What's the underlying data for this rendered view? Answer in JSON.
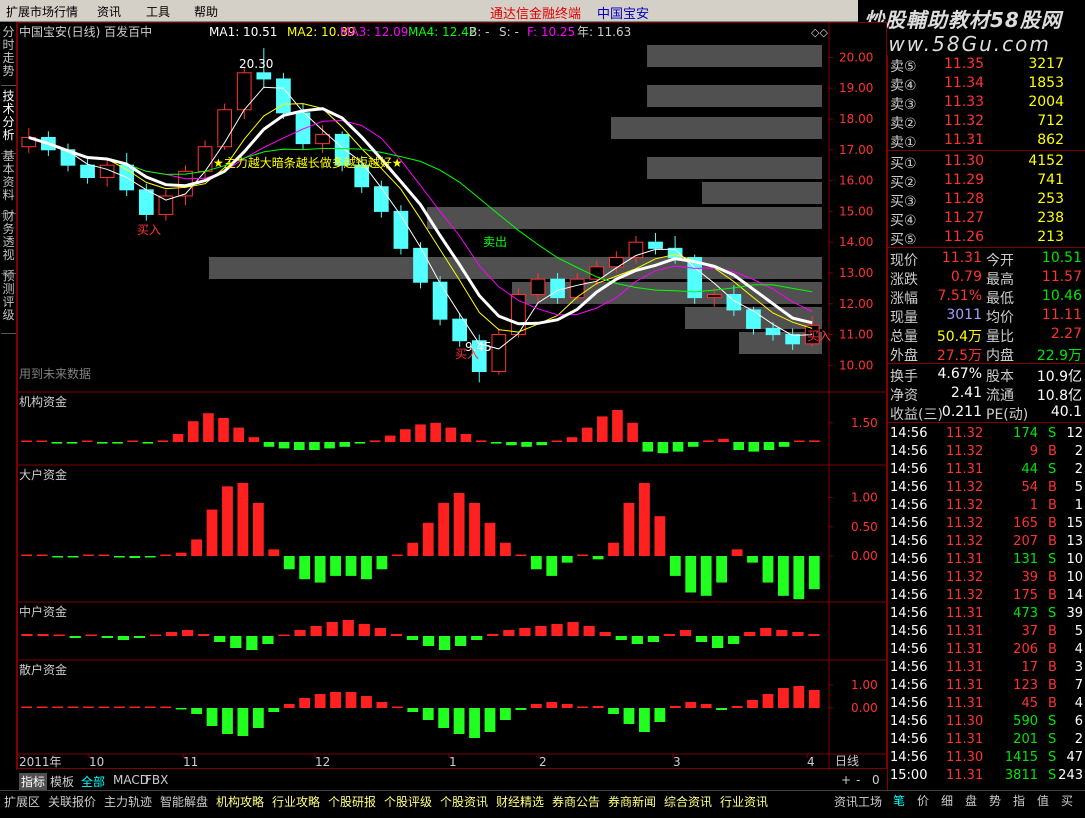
{
  "menu": {
    "items": [
      "扩展市场行情",
      "资讯",
      "工具",
      "帮助"
    ],
    "brand": "通达信金融终端",
    "stock": "中国宝安"
  },
  "watermark": {
    "line1": "炒股輔助教材58股网",
    "line2": "www.58Gu.com"
  },
  "left_tabs": [
    "分时走势",
    "技术分析",
    "基本资料",
    "财务透视",
    "预测评级"
  ],
  "chart_header": {
    "title": "中国宝安(日线) 百发百中",
    "ma1": "MA1: 10.51",
    "ma2": "MA2: 10.89",
    "ma3": "MA3: 12.09",
    "ma4": "MA4: 12.42",
    "b": "B: -",
    "s": "S: -",
    "f": "F: 10.25",
    "year": "年: 11.63"
  },
  "chart_data": [
    {
      "type": "candlestick",
      "title": "中国宝安(日线) 百发百中",
      "y_ticks": [
        10,
        11,
        12,
        13,
        14,
        15,
        16,
        17,
        18,
        19,
        20
      ],
      "y_tick_labels": [
        "10.00",
        "11.00",
        "12.00",
        "13.00",
        "14.00",
        "15.00",
        "16.00",
        "17.00",
        "18.00",
        "19.00",
        "20.00"
      ],
      "ylim": [
        9.2,
        20.5
      ],
      "x_ticks": [
        "2011年",
        "10",
        "11",
        "12",
        "1",
        "2",
        "3",
        "4"
      ],
      "annotations": [
        "20.30",
        "9.45",
        "买入",
        "卖出",
        "★主力越大暗条越长做多越短越好★",
        "用到未来数据"
      ],
      "candles": [
        [
          17.1,
          17.7,
          16.9,
          17.4
        ],
        [
          17.4,
          17.6,
          16.8,
          17.0
        ],
        [
          17.0,
          17.2,
          16.3,
          16.5
        ],
        [
          16.5,
          16.8,
          15.9,
          16.1
        ],
        [
          16.1,
          16.7,
          15.8,
          16.5
        ],
        [
          16.5,
          16.9,
          15.5,
          15.7
        ],
        [
          15.7,
          15.9,
          14.7,
          14.9
        ],
        [
          14.9,
          15.7,
          14.7,
          15.5
        ],
        [
          15.5,
          16.5,
          15.2,
          16.3
        ],
        [
          16.3,
          17.3,
          16.0,
          17.1
        ],
        [
          17.1,
          18.5,
          17.0,
          18.3
        ],
        [
          18.3,
          19.7,
          18.0,
          19.5
        ],
        [
          19.5,
          20.3,
          19.0,
          19.3
        ],
        [
          19.3,
          19.5,
          18.0,
          18.2
        ],
        [
          18.2,
          18.5,
          17.0,
          17.2
        ],
        [
          17.2,
          17.8,
          16.9,
          17.5
        ],
        [
          17.5,
          17.6,
          16.3,
          16.5
        ],
        [
          16.5,
          16.8,
          15.6,
          15.8
        ],
        [
          15.8,
          16.0,
          14.8,
          15.0
        ],
        [
          15.0,
          15.2,
          13.6,
          13.8
        ],
        [
          13.8,
          14.0,
          12.5,
          12.7
        ],
        [
          12.7,
          12.9,
          11.3,
          11.5
        ],
        [
          11.5,
          11.7,
          10.6,
          10.8
        ],
        [
          10.8,
          11.0,
          9.45,
          9.8
        ],
        [
          9.8,
          11.2,
          9.7,
          11.0
        ],
        [
          11.0,
          12.5,
          10.9,
          12.3
        ],
        [
          12.3,
          13.0,
          12.0,
          12.8
        ],
        [
          12.8,
          13.0,
          12.0,
          12.2
        ],
        [
          12.2,
          13.0,
          12.1,
          12.8
        ],
        [
          12.8,
          13.4,
          12.6,
          13.2
        ],
        [
          13.2,
          13.7,
          13.0,
          13.5
        ],
        [
          13.5,
          14.2,
          13.3,
          14.0
        ],
        [
          14.0,
          14.3,
          13.6,
          13.8
        ],
        [
          13.8,
          14.2,
          13.3,
          13.5
        ],
        [
          13.5,
          13.6,
          12.0,
          12.2
        ],
        [
          12.2,
          12.5,
          11.9,
          12.3
        ],
        [
          12.3,
          12.6,
          11.6,
          11.8
        ],
        [
          11.8,
          11.9,
          11.0,
          11.2
        ],
        [
          11.2,
          11.4,
          10.8,
          11.0
        ],
        [
          11.0,
          11.2,
          10.5,
          10.7
        ],
        [
          10.7,
          11.6,
          10.6,
          11.3
        ]
      ]
    },
    {
      "type": "bar",
      "title": "机构资金",
      "y_ticks": [
        1.5
      ],
      "y_tick_labels": [
        "1.50"
      ],
      "ylim": [
        -1.0,
        2.5
      ],
      "values": [
        0,
        0,
        -0.1,
        -0.1,
        0,
        -0.1,
        -0.1,
        0,
        -0.1,
        0.1,
        0.5,
        1.3,
        1.8,
        1.5,
        0.9,
        0.3,
        -0.3,
        -0.4,
        -0.5,
        -0.5,
        -0.4,
        -0.3,
        -0.1,
        0.1,
        0.4,
        0.8,
        1.1,
        1.2,
        0.9,
        0.5,
        0.1,
        -0.1,
        -0.2,
        -0.3,
        -0.2,
        0,
        0.3,
        0.9,
        1.6,
        2.0,
        1.2,
        -0.6,
        -0.7,
        -0.6,
        -0.3,
        0.1,
        0.2,
        -0.5,
        -0.6,
        -0.5,
        -0.3,
        0,
        0.1
      ]
    },
    {
      "type": "bar",
      "title": "大户资金",
      "y_ticks": [
        0,
        0.5,
        1.0
      ],
      "y_tick_labels": [
        "0.00",
        "0.50",
        "1.00"
      ],
      "ylim": [
        -0.7,
        1.25
      ],
      "values": [
        0,
        0,
        -0.02,
        -0.02,
        0,
        0,
        -0.02,
        -0.03,
        -0.02,
        0,
        0.05,
        0.25,
        0.7,
        1.05,
        1.1,
        0.8,
        0.1,
        -0.2,
        -0.35,
        -0.4,
        -0.3,
        -0.3,
        -0.35,
        -0.2,
        0,
        0.2,
        0.5,
        0.8,
        0.95,
        0.8,
        0.5,
        0.2,
        0,
        -0.2,
        -0.3,
        -0.1,
        0,
        -0.05,
        0.2,
        0.8,
        1.1,
        0.6,
        -0.3,
        -0.55,
        -0.6,
        -0.4,
        0.1,
        -0.1,
        -0.4,
        -0.6,
        -0.65,
        -0.5
      ]
    },
    {
      "type": "bar",
      "title": "中户资金",
      "values": [
        0.1,
        0.1,
        0,
        -0.1,
        0,
        -0.1,
        -0.2,
        -0.1,
        0,
        0.2,
        0.3,
        0.1,
        -0.3,
        -0.6,
        -0.7,
        -0.4,
        0,
        0.3,
        0.5,
        0.7,
        0.8,
        0.6,
        0.4,
        0.1,
        -0.2,
        -0.5,
        -0.7,
        -0.5,
        -0.2,
        0.1,
        0.3,
        0.4,
        0.5,
        0.6,
        0.7,
        0.5,
        0.2,
        -0.2,
        -0.4,
        -0.3,
        0.1,
        0.3,
        -0.3,
        -0.6,
        -0.4,
        0.2,
        0.4,
        0.3,
        0.2,
        0.1
      ]
    },
    {
      "type": "bar",
      "title": "散户资金",
      "y_ticks": [
        0,
        1.0
      ],
      "y_tick_labels": [
        "0.00",
        "1.00"
      ],
      "ylim": [
        -1.7,
        1.3
      ],
      "values": [
        0,
        0,
        0.02,
        0.02,
        0,
        0,
        0.03,
        0.05,
        0.03,
        0,
        -0.05,
        -0.3,
        -0.9,
        -1.3,
        -1.4,
        -1.0,
        -0.2,
        0.2,
        0.5,
        0.7,
        0.8,
        0.8,
        0.6,
        0.3,
        0,
        -0.2,
        -0.6,
        -1.0,
        -1.3,
        -1.5,
        -1.2,
        -0.6,
        -0.1,
        0.2,
        0.3,
        0.2,
        0,
        0.1,
        -0.3,
        -0.8,
        -1.2,
        -0.7,
        0.1,
        0.3,
        0.2,
        -0.1,
        0.1,
        0.4,
        0.7,
        1.0,
        1.1,
        0.9
      ]
    }
  ],
  "quote": {
    "asks": [
      {
        "label": "卖⑤",
        "price": "11.35",
        "vol": "3217"
      },
      {
        "label": "卖④",
        "price": "11.34",
        "vol": "1853"
      },
      {
        "label": "卖③",
        "price": "11.33",
        "vol": "2004"
      },
      {
        "label": "卖②",
        "price": "11.32",
        "vol": "712"
      },
      {
        "label": "卖①",
        "price": "11.31",
        "vol": "862"
      }
    ],
    "bids": [
      {
        "label": "买①",
        "price": "11.30",
        "vol": "4152"
      },
      {
        "label": "买②",
        "price": "11.29",
        "vol": "741"
      },
      {
        "label": "买③",
        "price": "11.28",
        "vol": "253"
      },
      {
        "label": "买④",
        "price": "11.27",
        "vol": "238"
      },
      {
        "label": "买⑤",
        "price": "11.26",
        "vol": "213"
      }
    ],
    "stats": [
      {
        "l1": "现价",
        "v1": "11.31",
        "l2": "今开",
        "v2": "10.51"
      },
      {
        "l1": "涨跌",
        "v1": "0.79",
        "l2": "最高",
        "v2": "11.57"
      },
      {
        "l1": "涨幅",
        "v1": "7.51%",
        "l2": "最低",
        "v2": "10.46"
      },
      {
        "l1": "现量",
        "v1": "3011",
        "l2": "均价",
        "v2": "11.11"
      },
      {
        "l1": "总量",
        "v1": "50.4万",
        "l2": "量比",
        "v2": "2.27"
      },
      {
        "l1": "外盘",
        "v1": "27.5万",
        "l2": "内盘",
        "v2": "22.9万"
      }
    ],
    "fin": [
      {
        "l1": "换手",
        "v1": "4.67%",
        "l2": "股本",
        "v2": "10.9亿"
      },
      {
        "l1": "净资",
        "v1": "2.41",
        "l2": "流通",
        "v2": "10.8亿"
      },
      {
        "l1": "收益(三)",
        "v1": "0.211",
        "l2": "PE(动)",
        "v2": "40.1"
      }
    ],
    "ticks": [
      {
        "t": "14:56",
        "p": "11.32",
        "v": "174",
        "d": "S",
        "n": "12"
      },
      {
        "t": "14:56",
        "p": "11.32",
        "v": "9",
        "d": "B",
        "n": "2"
      },
      {
        "t": "14:56",
        "p": "11.31",
        "v": "44",
        "d": "S",
        "n": "2"
      },
      {
        "t": "14:56",
        "p": "11.32",
        "v": "54",
        "d": "B",
        "n": "5"
      },
      {
        "t": "14:56",
        "p": "11.32",
        "v": "1",
        "d": "B",
        "n": "1"
      },
      {
        "t": "14:56",
        "p": "11.32",
        "v": "165",
        "d": "B",
        "n": "15"
      },
      {
        "t": "14:56",
        "p": "11.32",
        "v": "207",
        "d": "B",
        "n": "13"
      },
      {
        "t": "14:56",
        "p": "11.31",
        "v": "131",
        "d": "S",
        "n": "10"
      },
      {
        "t": "14:56",
        "p": "11.32",
        "v": "39",
        "d": "B",
        "n": "10"
      },
      {
        "t": "14:56",
        "p": "11.32",
        "v": "175",
        "d": "B",
        "n": "14"
      },
      {
        "t": "14:56",
        "p": "11.31",
        "v": "473",
        "d": "S",
        "n": "39"
      },
      {
        "t": "14:56",
        "p": "11.31",
        "v": "37",
        "d": "B",
        "n": "5"
      },
      {
        "t": "14:56",
        "p": "11.31",
        "v": "206",
        "d": "B",
        "n": "4"
      },
      {
        "t": "14:56",
        "p": "11.31",
        "v": "17",
        "d": "B",
        "n": "3"
      },
      {
        "t": "14:56",
        "p": "11.31",
        "v": "123",
        "d": "B",
        "n": "7"
      },
      {
        "t": "14:56",
        "p": "11.31",
        "v": "45",
        "d": "B",
        "n": "4"
      },
      {
        "t": "14:56",
        "p": "11.30",
        "v": "590",
        "d": "S",
        "n": "6"
      },
      {
        "t": "14:56",
        "p": "11.31",
        "v": "201",
        "d": "S",
        "n": "2"
      },
      {
        "t": "14:56",
        "p": "11.30",
        "v": "1415",
        "d": "S",
        "n": "47"
      },
      {
        "t": "15:00",
        "p": "11.31",
        "v": "3811",
        "d": "S",
        "n": "243"
      }
    ]
  },
  "period": "日线",
  "zoom": {
    "plus": "+",
    "minus": "-",
    "zero": "0"
  },
  "bottom_tabs": [
    "指标",
    "模板",
    "全部",
    "MACD",
    "FBX"
  ],
  "status": [
    "扩展区",
    "关联报价",
    "主力轨迹",
    "智能解盘",
    "机构攻略",
    "行业攻略",
    "个股研报",
    "个股评级",
    "个股资讯",
    "财经精选",
    "券商公告",
    "券商新闻",
    "综合资讯",
    "行业资讯",
    "资讯工场"
  ],
  "right_tabs": [
    "笔",
    "价",
    "细",
    "盘",
    "势",
    "指",
    "值",
    "买"
  ]
}
